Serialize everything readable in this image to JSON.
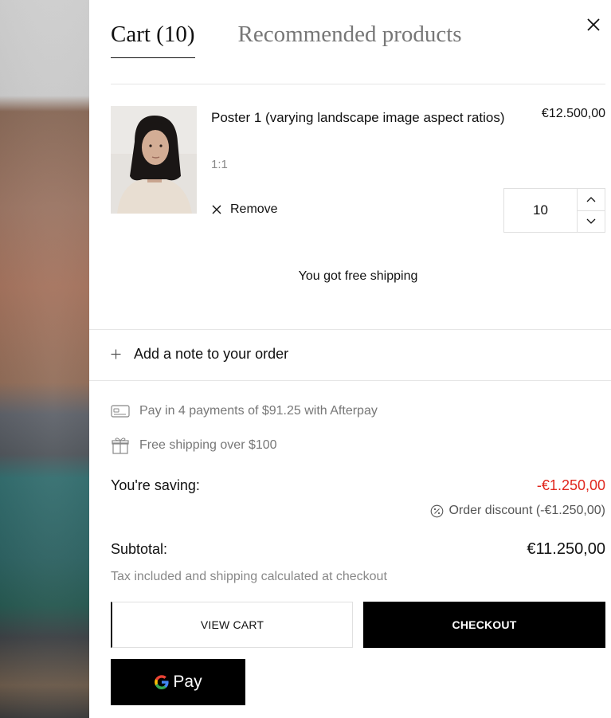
{
  "tabs": [
    {
      "label": "Cart (10)",
      "active": true
    },
    {
      "label": "Recommended products",
      "active": false
    }
  ],
  "close_icon": "close-icon",
  "item": {
    "title": "Poster 1 (varying landscape image aspect ratios)",
    "variant": "1:1",
    "price": "€12.500,00",
    "remove_label": "Remove",
    "quantity": "10"
  },
  "shipping_message": "You got free shipping",
  "note_label": "Add a note to your order",
  "promos": {
    "afterpay": "Pay in 4 payments of $91.25 with Afterpay",
    "free_shipping": "Free shipping over $100"
  },
  "saving": {
    "label": "You're saving:",
    "value": "-€1.250,00",
    "discount_line": "Order discount (-€1.250,00)"
  },
  "subtotal": {
    "label": "Subtotal:",
    "value": "€11.250,00",
    "tax_note": "Tax included and shipping calculated at checkout"
  },
  "buttons": {
    "view_cart": "VIEW CART",
    "checkout": "CHECKOUT",
    "gpay": "Pay"
  },
  "colors": {
    "accent_red": "#e0261d",
    "button_black": "#000000"
  }
}
